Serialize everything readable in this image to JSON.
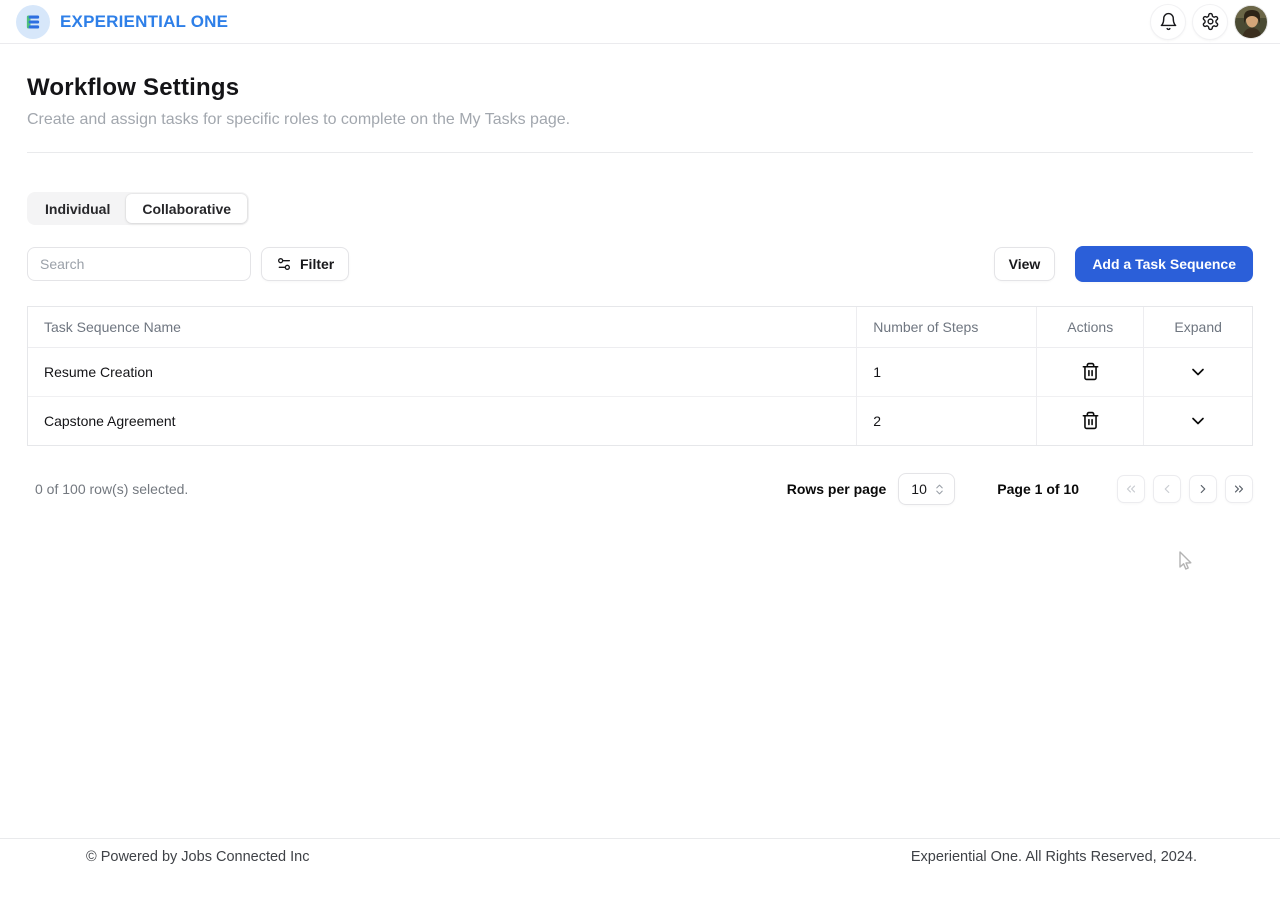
{
  "header": {
    "brand": "EXPERIENTIAL ONE"
  },
  "page": {
    "title": "Workflow Settings",
    "subtitle": "Create and assign tasks for specific roles to complete on the My Tasks page."
  },
  "tabs": [
    {
      "label": "Individual",
      "active": false
    },
    {
      "label": "Collaborative",
      "active": true
    }
  ],
  "toolbar": {
    "search_placeholder": "Search",
    "filter_label": "Filter",
    "view_label": "View",
    "add_label": "Add a Task Sequence"
  },
  "table": {
    "columns": [
      "Task Sequence Name",
      "Number of Steps",
      "Actions",
      "Expand"
    ],
    "rows": [
      {
        "name": "Resume Creation",
        "steps": "1"
      },
      {
        "name": "Capstone Agreement",
        "steps": "2"
      }
    ]
  },
  "pagination": {
    "selected_text": "0 of 100 row(s) selected.",
    "rows_per_page_label": "Rows per page",
    "rows_per_page_value": "10",
    "page_text": "Page 1 of 10"
  },
  "footer": {
    "left": "© Powered by Jobs Connected Inc",
    "right": "Experiential One. All Rights Reserved, 2024."
  },
  "colors": {
    "accent_blue": "#2b5fd9",
    "brand_blue": "#2e7fe8",
    "logo_badge_bg": "#d7e7fa",
    "logo_green": "#4fc07c"
  }
}
